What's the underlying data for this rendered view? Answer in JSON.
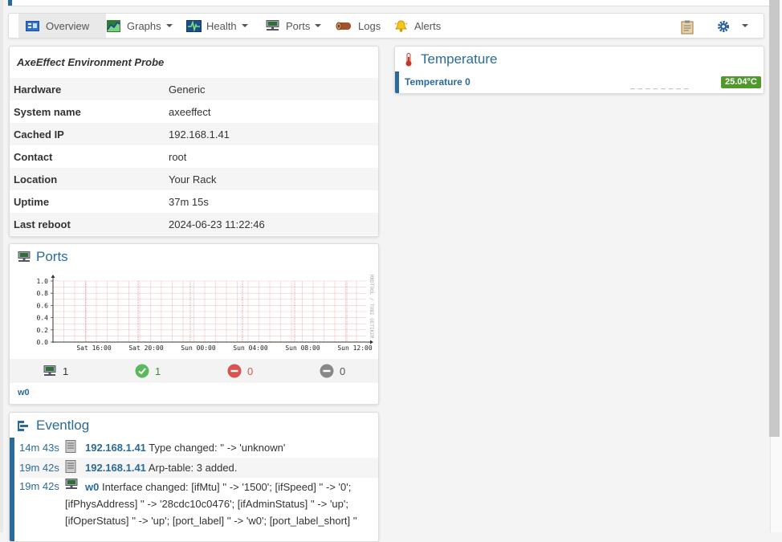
{
  "nav": {
    "overview": "Overview",
    "graphs": "Graphs",
    "health": "Health",
    "ports": "Ports",
    "logs": "Logs",
    "alerts": "Alerts"
  },
  "overview": {
    "title": "AxeEffect Environment Probe",
    "rows": [
      {
        "label": "Hardware",
        "value": "Generic"
      },
      {
        "label": "System name",
        "value": "axeeffect"
      },
      {
        "label": "Cached IP",
        "value": "192.168.1.41"
      },
      {
        "label": "Contact",
        "value": "root"
      },
      {
        "label": "Location",
        "value": "Your Rack"
      },
      {
        "label": "Uptime",
        "value": "37m 15s"
      },
      {
        "label": "Last reboot",
        "value": "2024-06-23 11:22:46"
      }
    ]
  },
  "ports": {
    "title": "Ports",
    "total": "1",
    "up": "1",
    "down": "0",
    "disabled": "0",
    "port_link": "w0"
  },
  "chart_data": {
    "type": "line",
    "x": [
      "Sat 16:00",
      "Sat 20:00",
      "Sun 00:00",
      "Sun 04:00",
      "Sun 08:00",
      "Sun 12:00"
    ],
    "yticks": [
      "1.0",
      "0.8",
      "0.6",
      "0.4",
      "0.2",
      "0.0"
    ],
    "ylim": [
      0,
      1
    ],
    "watermark": "RRDTOOL / TOBI OETIKER",
    "grid": true,
    "series": []
  },
  "eventlog": {
    "title": "Eventlog",
    "entries": [
      {
        "time": "14m 43s",
        "host": "192.168.1.41",
        "message": "Type changed: '' -> 'unknown'"
      },
      {
        "time": "19m 42s",
        "host": "192.168.1.41",
        "message": "Arp-table: 3 added."
      },
      {
        "time": "19m 42s",
        "host": "w0",
        "message": "Interface changed: [ifMtu] '' -> '1500'; [ifSpeed] '' -> '0';",
        "line2": "[ifPhysAddress] '' -> '28cdc10c0476'; [ifAdminStatus] '' -> 'up';",
        "line3": "[ifOperStatus] '' -> 'up'; [port_label] '' -> 'w0'; [port_label_short] ''"
      }
    ]
  },
  "temperature": {
    "title": "Temperature",
    "sensor": "Temperature 0",
    "value": "25.04°C",
    "badge_color": "#4f9a2a"
  },
  "colors": {
    "accent": "#2a6b9c",
    "green": "#5cb85c",
    "red": "#d9534f",
    "grey": "#888888"
  }
}
